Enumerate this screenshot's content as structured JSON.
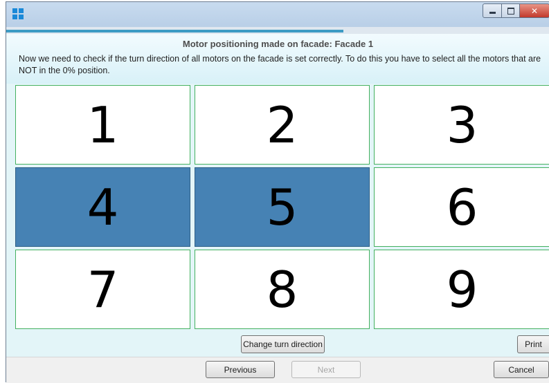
{
  "window": {
    "controls": {
      "minimize": "minimize",
      "maximize": "maximize",
      "close": "close"
    }
  },
  "progress": {
    "fraction": 0.62
  },
  "header": {
    "title": "Motor positioning made on facade: Facade 1",
    "instructions": "Now we need to check if the turn direction of all motors on the facade is set correctly. To do this you have to select all the motors that are NOT in the 0% position."
  },
  "motors": [
    {
      "label": "1",
      "selected": false
    },
    {
      "label": "2",
      "selected": false
    },
    {
      "label": "3",
      "selected": false
    },
    {
      "label": "4",
      "selected": true
    },
    {
      "label": "5",
      "selected": true
    },
    {
      "label": "6",
      "selected": false
    },
    {
      "label": "7",
      "selected": false
    },
    {
      "label": "8",
      "selected": false
    },
    {
      "label": "9",
      "selected": false
    }
  ],
  "actions": {
    "change_turn_direction": "Change turn direction",
    "print": "Print"
  },
  "nav": {
    "previous": "Previous",
    "next": "Next",
    "cancel": "Cancel"
  },
  "colors": {
    "selected_cell": "#4682b4",
    "cell_border": "#43b05f",
    "progress": "#3d9bc4"
  }
}
